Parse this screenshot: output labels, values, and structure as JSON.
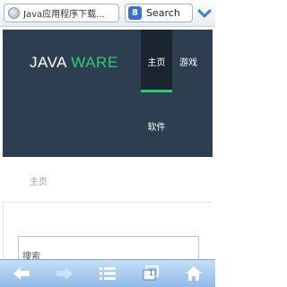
{
  "browser": {
    "url_text": "Java应用程序下载...",
    "search_placeholder": "Search",
    "search_engine_letter": "8",
    "tab_count": "1"
  },
  "site": {
    "logo_java": "JAVA",
    "logo_ware": "WARE",
    "nav": {
      "home": "主页",
      "games": "游戏",
      "software": "软件"
    },
    "breadcrumb": "主页",
    "search_box_placeholder": "搜索"
  },
  "colors": {
    "header_bg": "#2c3e50",
    "accent": "#2ecc71",
    "toolbar": "#8fbbe8"
  }
}
